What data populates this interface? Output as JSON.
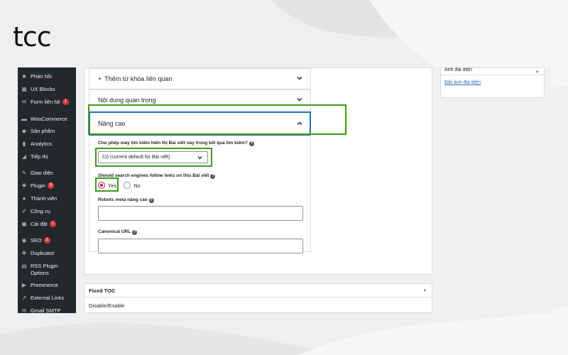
{
  "brand": {
    "logo": "tcc"
  },
  "sidebar": {
    "items": [
      {
        "label": "Phản hồi",
        "icon": "comment-icon"
      },
      {
        "label": "UX Blocks",
        "icon": "blocks-icon"
      },
      {
        "label": "Form liên hệ",
        "icon": "mail-icon",
        "badge": "1"
      },
      {
        "label": "WooCommerce",
        "icon": "woo-icon"
      },
      {
        "label": "Sản phẩm",
        "icon": "box-icon"
      },
      {
        "label": "Analytics",
        "icon": "chart-icon"
      },
      {
        "label": "Tiếp thị",
        "icon": "megaphone-icon"
      },
      {
        "label": "Giao diện",
        "icon": "brush-icon"
      },
      {
        "label": "Plugin",
        "icon": "plug-icon",
        "badge": "9"
      },
      {
        "label": "Thành viên",
        "icon": "user-icon"
      },
      {
        "label": "Công cụ",
        "icon": "wrench-icon"
      },
      {
        "label": "Cài đặt",
        "icon": "settings-icon",
        "badge": "1"
      },
      {
        "label": "SEO",
        "icon": "seo-icon",
        "badge": "1"
      },
      {
        "label": "Duplicator",
        "icon": "duplicator-icon"
      },
      {
        "label": "RSS Plugin Options",
        "icon": "rss-icon"
      },
      {
        "label": "Premmerce",
        "icon": "premmerce-icon"
      },
      {
        "label": "External Links",
        "icon": "external-link-icon"
      },
      {
        "label": "Gmail SMTP",
        "icon": "gmail-icon"
      }
    ]
  },
  "accordion": {
    "related_keywords": "Thêm từ khóa liên quan",
    "cornerstone": "Nội dung quan trọng",
    "advanced": "Nâng cao"
  },
  "advanced": {
    "allow_search_label": "Cho phép máy tìm kiếm hiển thị Bài viết này trong kết quả tìm kiếm?",
    "allow_search_value": "Có (current default for Bài viết)",
    "follow_links_label": "Should search engines follow links on this Bài viết",
    "follow_yes": "Yes",
    "follow_no": "No",
    "follow_selected": "Yes",
    "robots_meta_label": "Robots meta nâng cao",
    "canonical_label": "Canonical URL"
  },
  "featured_image": {
    "title": "Ảnh đại diện",
    "link": "Đặt ảnh đại diện"
  },
  "fixed_toc": {
    "title": "Fixed TOC",
    "row_label": "Disable/Enable"
  },
  "colors": {
    "highlight": "#3c9a1a",
    "sidebar_bg": "#23282d",
    "link": "#2271b1",
    "radio_checked": "#c2185b"
  }
}
